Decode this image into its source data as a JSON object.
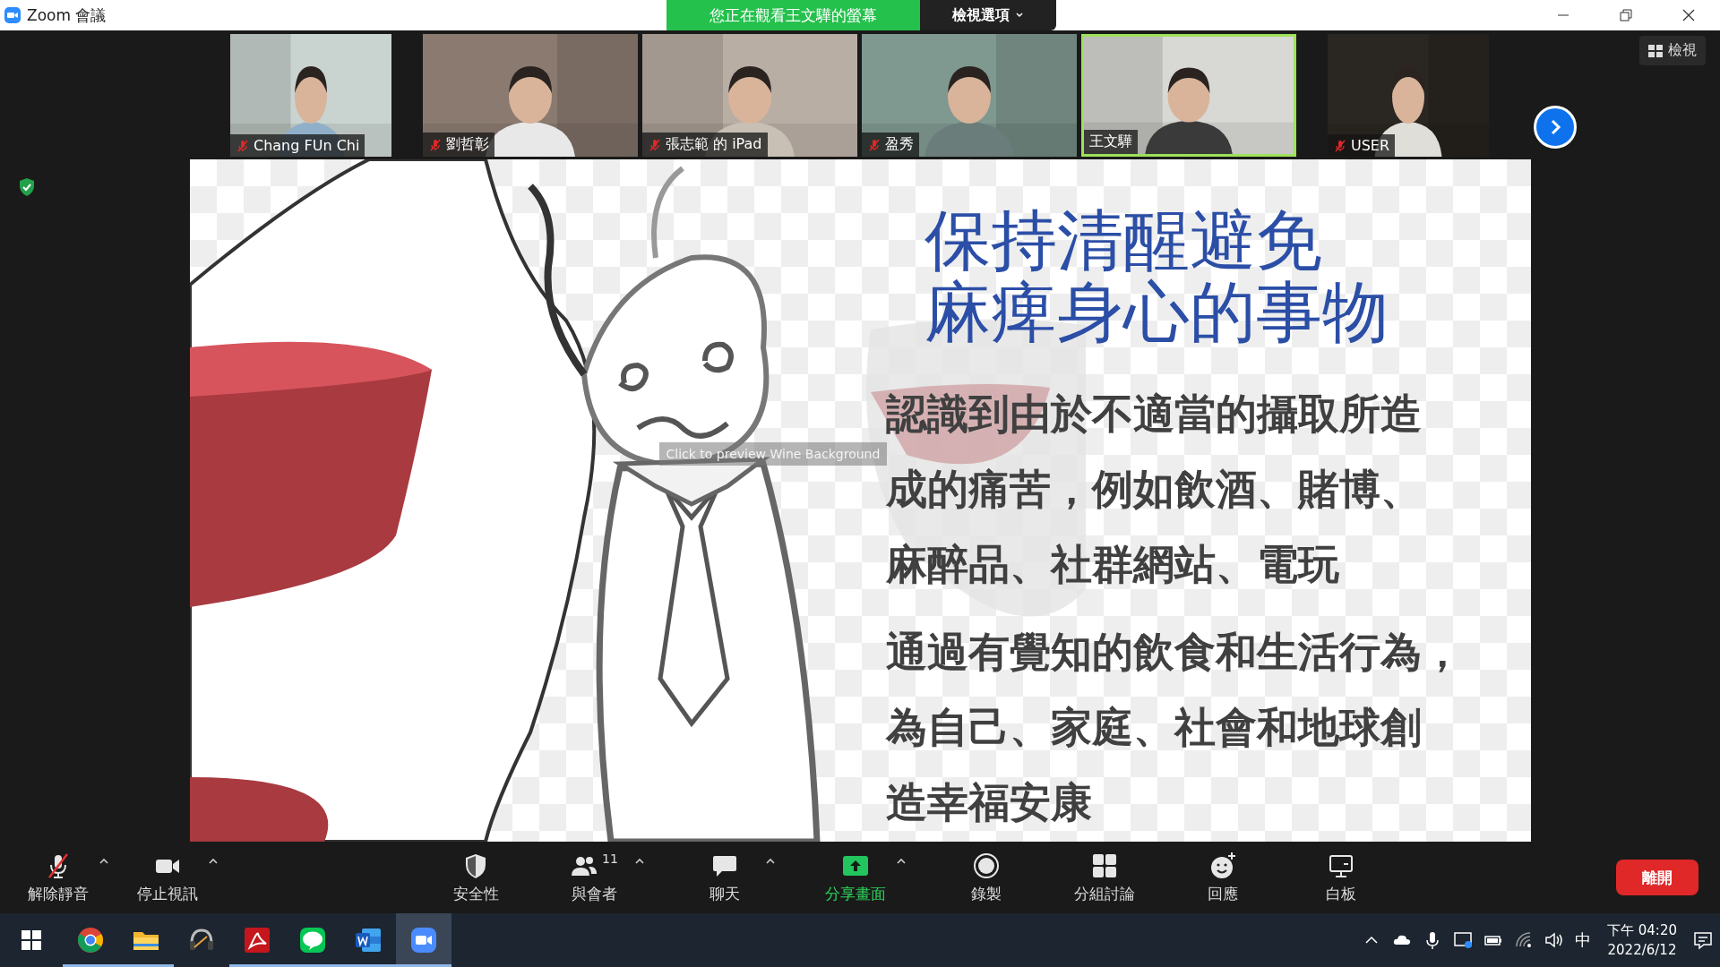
{
  "window": {
    "app_title": "Zoom 會議",
    "viewing_banner": "您正在觀看王文驊的螢幕",
    "view_options": "檢視選項"
  },
  "view_button": "檢視",
  "participants": [
    {
      "name": "Chang FUn Chi",
      "muted": true,
      "speaking": false
    },
    {
      "name": "劉哲彰",
      "muted": true,
      "speaking": false
    },
    {
      "name": "張志範 的 iPad",
      "muted": true,
      "speaking": false
    },
    {
      "name": "盈秀",
      "muted": true,
      "speaking": false
    },
    {
      "name": "王文驊",
      "muted": false,
      "speaking": true
    },
    {
      "name": "USER",
      "muted": true,
      "speaking": false
    }
  ],
  "slide": {
    "title_lines": [
      "保持清醒避免",
      "麻痺身心的事物"
    ],
    "paragraphs": [
      {
        "lines": [
          "認識到由於不適當的攝取所造",
          "成的痛苦，例如飲酒、賭博、",
          "麻醉品、社群網站、電玩"
        ]
      },
      {
        "lines": [
          "通過有覺知的飲食和生活行為，",
          "為自己、家庭、社會和地球創",
          "造幸福安康"
        ]
      }
    ],
    "tooltip": "Click to preview Wine Background"
  },
  "toolbar": [
    {
      "kind": "mic",
      "label": "解除靜音",
      "caret": true,
      "highlighted": false
    },
    {
      "kind": "camera",
      "label": "停止視訊",
      "caret": true,
      "highlighted": false
    },
    {
      "kind": "shield",
      "label": "安全性",
      "caret": false,
      "highlighted": false
    },
    {
      "kind": "people",
      "label": "與會者",
      "count": "11",
      "caret": true,
      "highlighted": false
    },
    {
      "kind": "chat",
      "label": "聊天",
      "caret": true,
      "highlighted": false
    },
    {
      "kind": "share",
      "label": "分享畫面",
      "caret": true,
      "highlighted": true
    },
    {
      "kind": "record",
      "label": "錄製",
      "caret": false,
      "highlighted": false
    },
    {
      "kind": "grid",
      "label": "分組討論",
      "caret": false,
      "highlighted": false
    },
    {
      "kind": "reaction",
      "label": "回應",
      "caret": false,
      "highlighted": false
    },
    {
      "kind": "whiteboard",
      "label": "白板",
      "caret": false,
      "highlighted": false
    }
  ],
  "leave_button": "離開",
  "taskbar": {
    "apps": [
      {
        "kind": "chrome",
        "running": true,
        "active": false
      },
      {
        "kind": "folder",
        "running": true,
        "active": false
      },
      {
        "kind": "headset",
        "running": false,
        "active": false
      },
      {
        "kind": "acrobat",
        "running": true,
        "active": false
      },
      {
        "kind": "line",
        "running": true,
        "active": false
      },
      {
        "kind": "word",
        "running": true,
        "active": false
      },
      {
        "kind": "zoom",
        "running": true,
        "active": true
      }
    ],
    "tray": {
      "ime": "中",
      "time": "下午 04:20",
      "date": "2022/6/12"
    }
  }
}
